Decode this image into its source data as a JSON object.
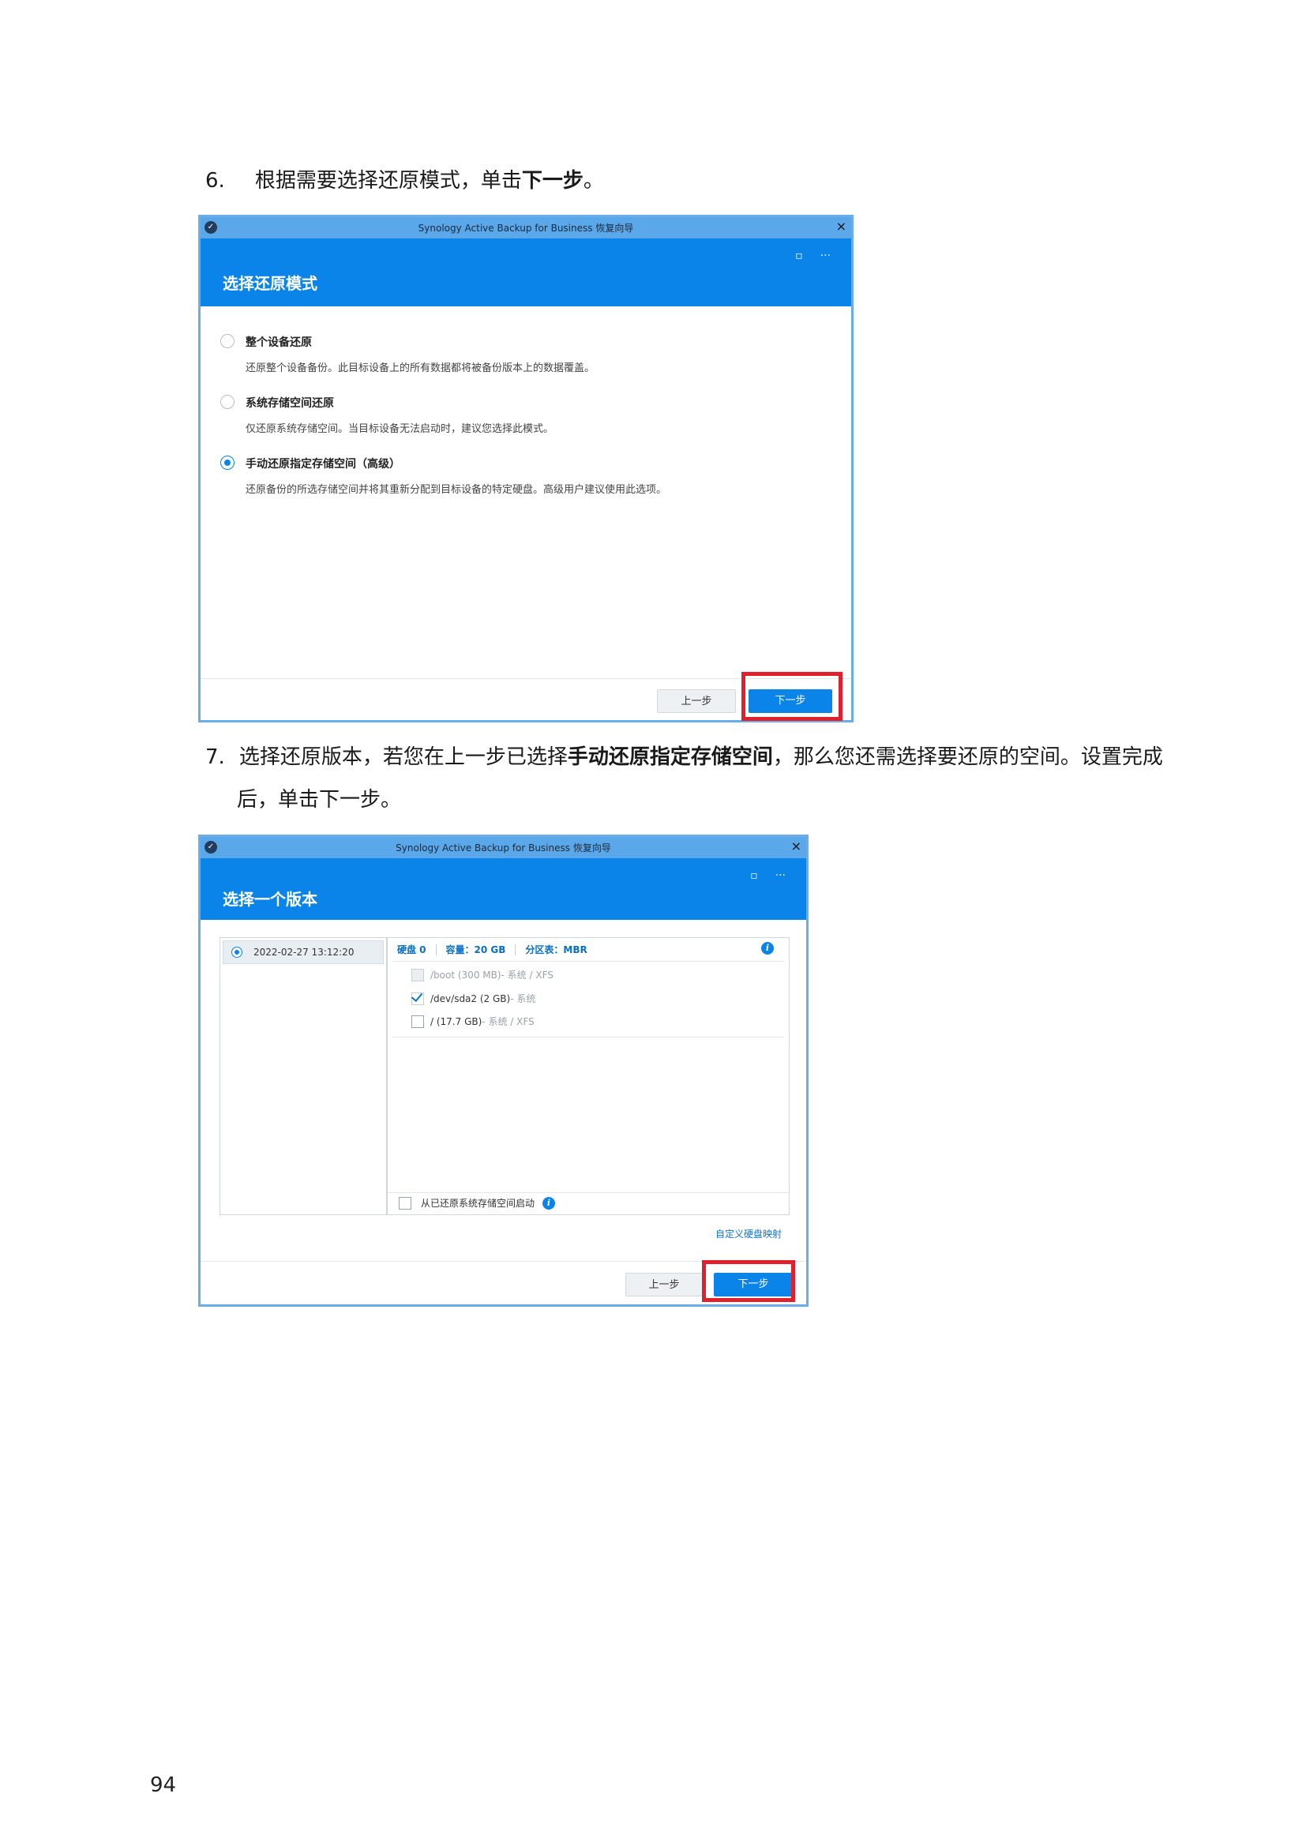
{
  "step6": {
    "number": "6.",
    "text_before": "根据需要选择还原模式，单击",
    "text_bold": "下一步",
    "text_after": "。"
  },
  "dialog1": {
    "window_title": "Synology Active Backup for Business 恢复向导",
    "close_glyph": "×",
    "header_title": "选择还原模式",
    "header_icons": [
      "▫",
      "···"
    ],
    "options": [
      {
        "label": "整个设备还原",
        "desc": "还原整个设备备份。此目标设备上的所有数据都将被备份版本上的数据覆盖。",
        "selected": false
      },
      {
        "label": "系统存储空间还原",
        "desc": "仅还原系统存储空间。当目标设备无法启动时，建议您选择此模式。",
        "selected": false
      },
      {
        "label": "手动还原指定存储空间（高级）",
        "desc": "还原备份的所选存储空间并将其重新分配到目标设备的特定硬盘。高级用户建议使用此选项。",
        "selected": true
      }
    ],
    "prev_button": "上一步",
    "next_button": "下一步"
  },
  "step7": {
    "number": "7.",
    "text_before": "选择还原版本，若您在上一步已选择",
    "text_bold": "手动还原指定存储空间",
    "text_after": "，那么您还需选择要还原的空间。设置完成",
    "text_line2": "后，单击下一步。"
  },
  "dialog2": {
    "window_title": "Synology Active Backup for Business 恢复向导",
    "close_glyph": "×",
    "header_title": "选择一个版本",
    "header_icons": [
      "▫",
      "···"
    ],
    "version": "2022-02-27 13:12:20",
    "disk_label": "硬盘 0",
    "capacity": "容量：20 GB",
    "partition_table": "分区表：MBR",
    "info_glyph": "i",
    "partitions": [
      {
        "name": "/boot (300 MB)",
        "detail": " - 系统 / XFS",
        "checked": false,
        "disabled": true
      },
      {
        "name": "/dev/sda2 (2 GB)",
        "detail": " - 系统",
        "checked": true,
        "disabled": false
      },
      {
        "name": "/ (17.7 GB)",
        "detail": " - 系统 / XFS",
        "checked": false,
        "disabled": false
      }
    ],
    "boot_option": "从已还原系统存储空间启动",
    "custom_mapping": "自定义硬盘映射",
    "prev_button": "上一步",
    "next_button": "下一步"
  },
  "page_number": "94"
}
